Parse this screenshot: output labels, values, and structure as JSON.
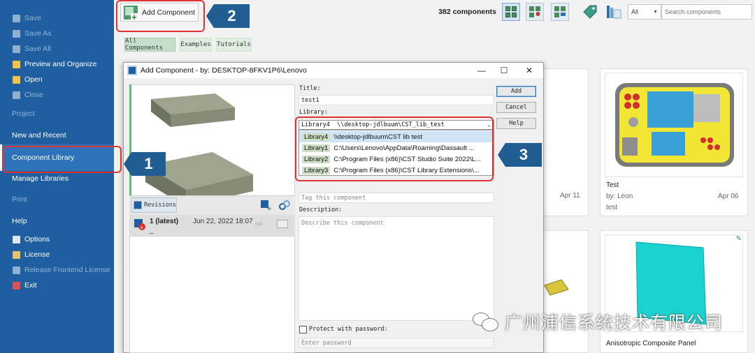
{
  "sidebar": {
    "items": [
      {
        "label": "Save",
        "icon": "save-icon",
        "dimmed": true
      },
      {
        "label": "Save As",
        "icon": "save-as-icon",
        "dimmed": true
      },
      {
        "label": "Save All",
        "icon": "save-all-icon",
        "dimmed": true
      },
      {
        "label": "Preview and Organize",
        "icon": "preview-organize-icon"
      },
      {
        "label": "Open",
        "icon": "open-folder-icon"
      },
      {
        "label": "Close",
        "icon": "close-doc-icon",
        "dimmed": true
      },
      {
        "label": "Project",
        "dimmed": true
      },
      {
        "label": "New and Recent"
      },
      {
        "label": "Component Library",
        "selected": true
      },
      {
        "label": "Manage Libraries"
      },
      {
        "label": "Print",
        "dimmed": true
      },
      {
        "label": "Help"
      },
      {
        "label": "Options",
        "icon": "options-icon"
      },
      {
        "label": "License",
        "icon": "license-icon"
      },
      {
        "label": "Release Frontend License",
        "icon": "release-license-icon",
        "dimmed": true
      },
      {
        "label": "Exit",
        "icon": "exit-icon"
      }
    ]
  },
  "toolbar": {
    "add_component_label": "Add Component",
    "tabs": [
      {
        "label": "All Components",
        "active": true
      },
      {
        "label": "Examples"
      },
      {
        "label": "Tutorials"
      }
    ],
    "component_count": "382 components",
    "filter_value": "All",
    "search_placeholder": "Search components"
  },
  "gallery": {
    "cards": [
      {
        "date": "Apr 11"
      },
      {
        "title": "Test",
        "author": "by: Leon",
        "date": "Apr 06",
        "tag": "test"
      },
      {
        "title": "Anisotropic Composite Panel"
      }
    ]
  },
  "dialog": {
    "title": "Add Component - by: DESKTOP-8FKV1P6\\Lenovo",
    "title_label": "Title:",
    "title_value": "test1",
    "library_label": "Library:",
    "selected_library": "Library4  \\\\desktop-jdlbuum\\CST_lib_test",
    "library_options": [
      {
        "name": "Library4",
        "path": "\\\\desktop-jdlbuum\\CST lib test",
        "highlighted": true
      },
      {
        "name": "Library1",
        "path": "C:\\Users\\Lenovo\\AppData\\Roaming\\Dassault ..."
      },
      {
        "name": "Library2",
        "path": "C:\\Program Files (x86)\\CST Studio Suite 2022\\L..."
      },
      {
        "name": "Library3",
        "path": "C:\\Program Files (x86)\\CST Library Extensions\\..."
      }
    ],
    "tag_placeholder": "Tag this component",
    "description_label": "Description:",
    "description_placeholder": "Describe this component",
    "protect_label": "Protect with password:",
    "password_placeholder": "Enter password",
    "buttons": {
      "add": "Add",
      "cancel": "Cancel",
      "help": "Help"
    },
    "revisions_label": "Revisions",
    "revision": {
      "number": "1 (latest)",
      "date": "Jun 22, 2022 18:07",
      "extra": "_"
    }
  },
  "annotations": {
    "one": "1",
    "two": "2",
    "three": "3"
  },
  "watermark": {
    "text": "广州浦信系统技术有限公司"
  },
  "colors": {
    "sidebar_bg": "#1f5fa1",
    "callout_red": "#e03434",
    "callout_blue": "#1f5d92",
    "panel_cyan": "#1ad2d0"
  }
}
